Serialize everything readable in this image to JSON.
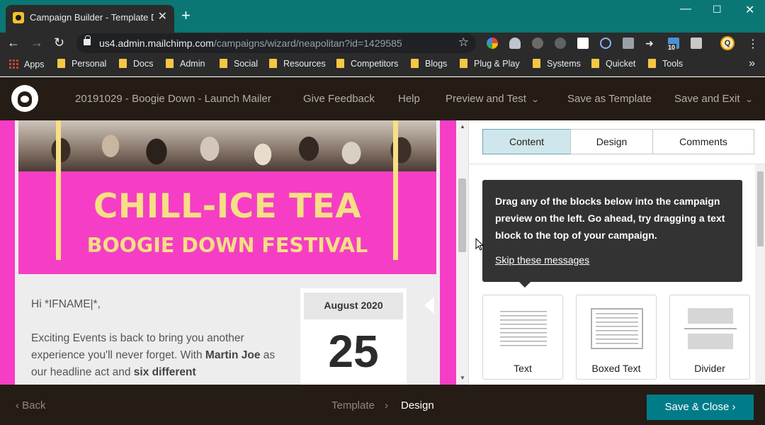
{
  "browser": {
    "tab_title": "Campaign Builder - Template Designer",
    "url_host": "us4.admin.mailchimp.com",
    "url_path": "/campaigns/wizard/neapolitan?id=1429585",
    "bookmarks": [
      "Apps",
      "Personal",
      "Docs",
      "Admin",
      "Social",
      "Resources",
      "Competitors",
      "Blogs",
      "Plug & Play",
      "Systems",
      "Quicket",
      "Tools"
    ],
    "profile_initial": "Q",
    "ext_badge": "10"
  },
  "app_header": {
    "campaign_name": "20191029 - Boogie Down - Launch Mailer",
    "give_feedback": "Give Feedback",
    "help": "Help",
    "preview_and_test": "Preview and Test",
    "save_as_template": "Save as Template",
    "save_and_exit": "Save and Exit"
  },
  "email": {
    "hero_title": "CHILL-ICE TEA",
    "hero_subtitle": "BOOGIE DOWN FESTIVAL",
    "greeting": "Hi *IFNAME|*,",
    "body_intro": "Exciting Events is back to bring you another experience you'll never forget. With ",
    "body_bold1": "Martin Joe",
    "body_mid": " as our headline act and ",
    "body_bold2": "six different",
    "date_month": "August 2020",
    "date_day": "25"
  },
  "panel": {
    "tabs": [
      "Content",
      "Design",
      "Comments"
    ],
    "active_tab": "Content",
    "tip_text": "Drag any of the blocks below into the campaign preview on the left. Go ahead, try dragging a text block to the top of your campaign.",
    "tip_link": "Skip these messages",
    "blocks": [
      "Text",
      "Boxed Text",
      "Divider"
    ]
  },
  "footer": {
    "back": "Back",
    "steps": [
      "Template",
      "Design"
    ],
    "current_step": "Design",
    "save_close": "Save & Close"
  },
  "colors": {
    "browser_teal": "#0a7775",
    "mailchimp_dark": "#241c15",
    "festival_pink": "#f53ec5",
    "festival_yellow": "#f6df84",
    "primary_button": "#007c89"
  }
}
